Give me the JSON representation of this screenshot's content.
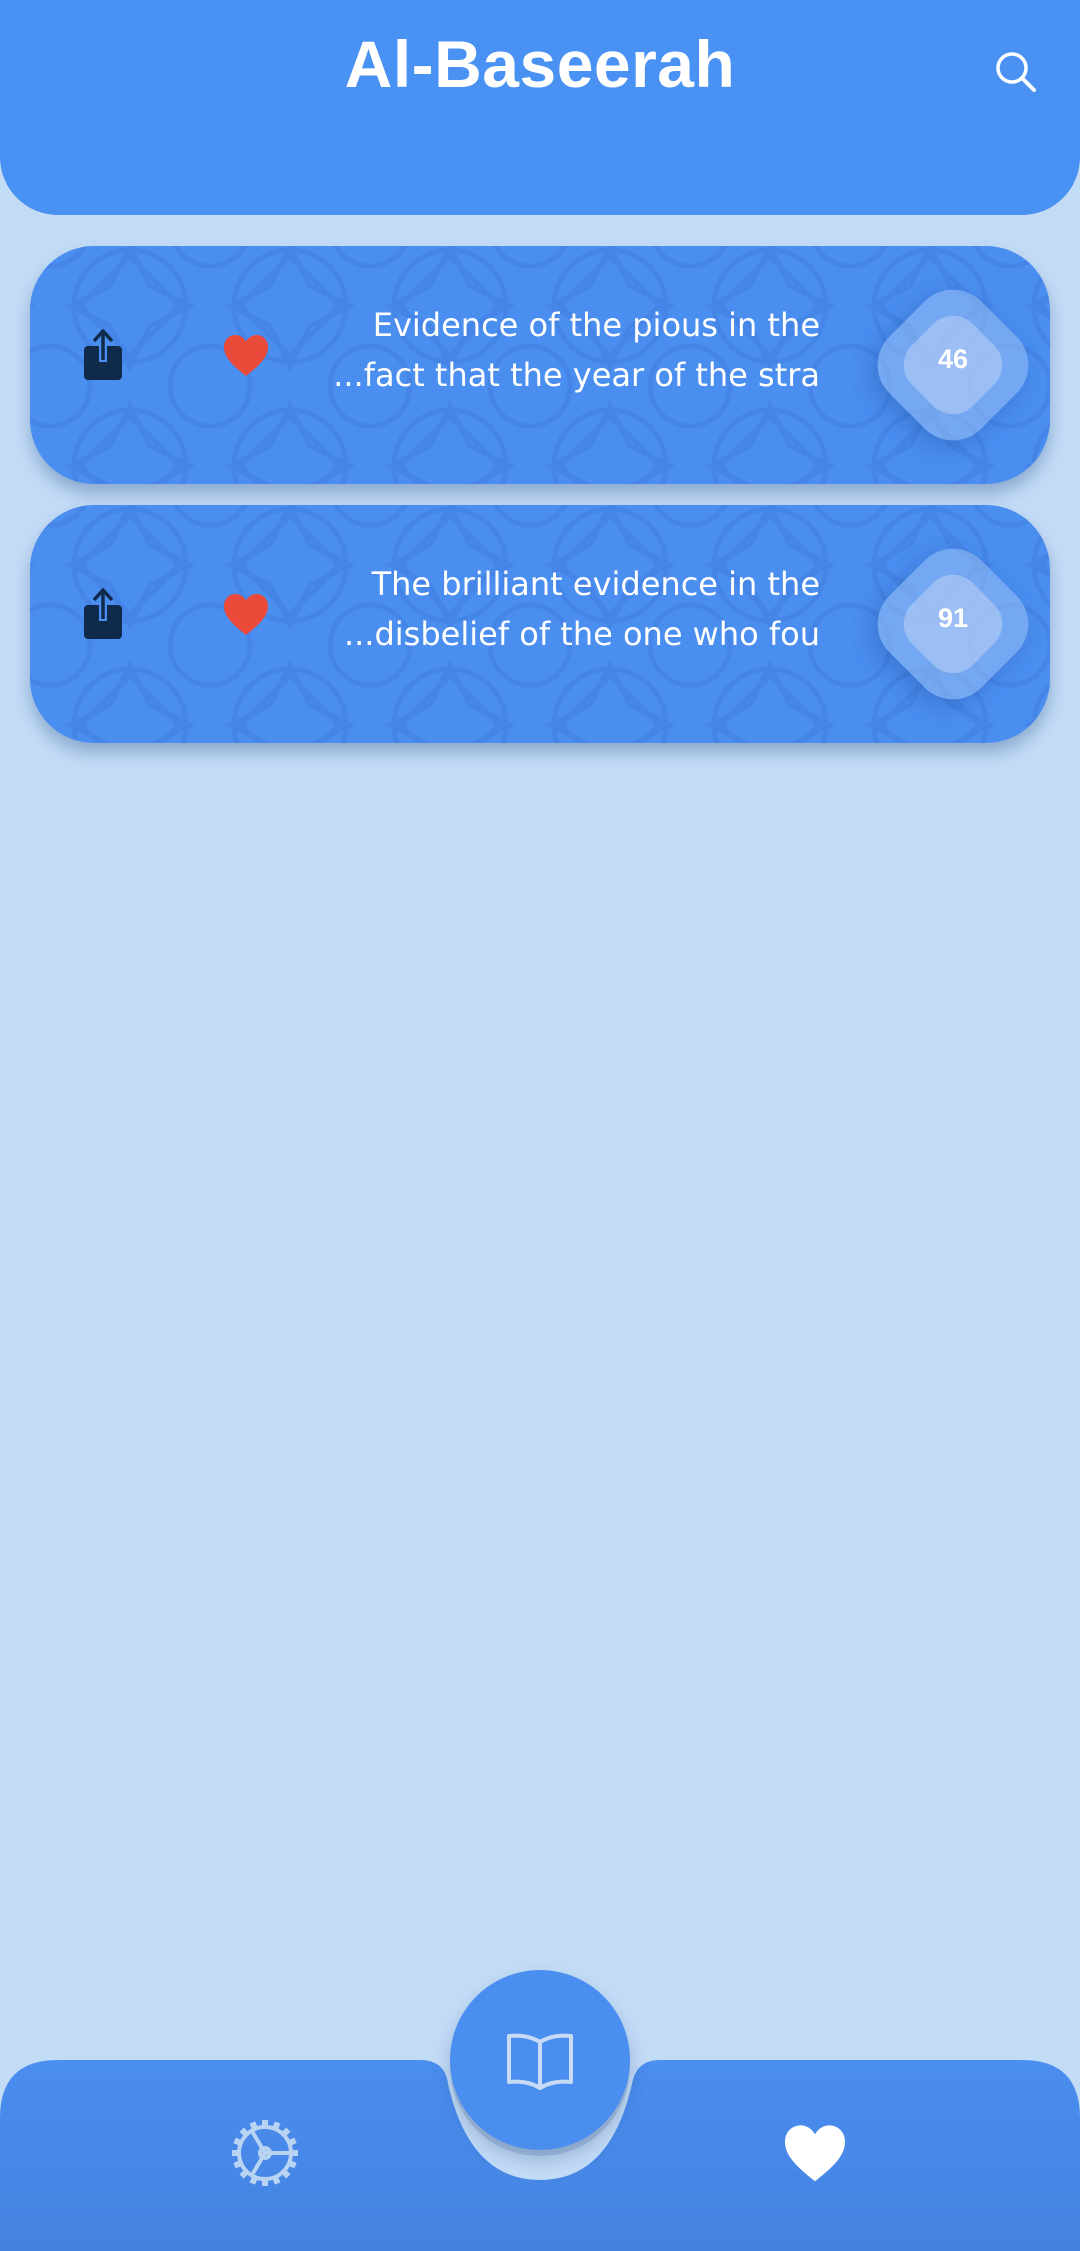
{
  "app": {
    "title": "Al-Baseerah"
  },
  "header": {
    "search_icon": "search-icon"
  },
  "favorites": [
    {
      "line1": "Evidence of the pious in the",
      "line2": "...fact that the year of the stra",
      "number": "46"
    },
    {
      "line1": "The brilliant evidence in the",
      "line2": "...disbelief of the one who fou",
      "number": "91"
    }
  ],
  "nav": {
    "left_icon": "settings-icon",
    "center_icon": "book-icon",
    "right_icon": "heart-icon"
  },
  "colors": {
    "background": "#c3dcf6",
    "primary": "#4991f2",
    "heart": "#ea4a3a",
    "share_icon": "#0f2a4a"
  }
}
